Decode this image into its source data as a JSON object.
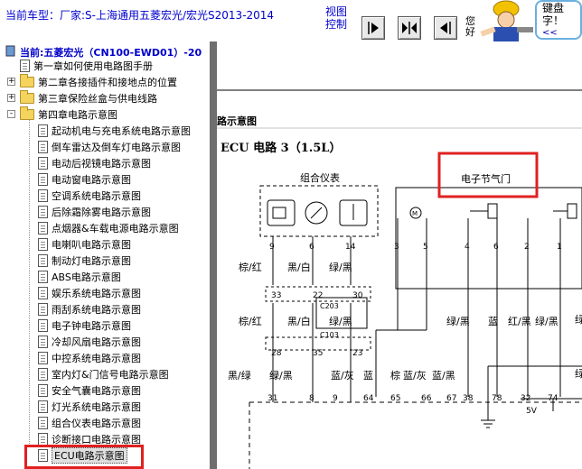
{
  "header": {
    "vehicle_label": "当前车型：厂家:S-上海通用五菱宏光/宏光S2013-2014",
    "view_control_label": "视图\n控制",
    "nav_button_hint": "您好",
    "mascot_text_line1": "键盘",
    "mascot_text_line2": "字！",
    "mascot_more": "<<"
  },
  "tree": {
    "root_label": "当前:五菱宏光（CN100-EWD01）-20",
    "items": [
      {
        "label": "第一章如何使用电路图手册",
        "type": "doc",
        "level": 1
      },
      {
        "label": "第二章各接插件和接地点的位置",
        "type": "folder",
        "level": 1,
        "expander": "+"
      },
      {
        "label": "第三章保险丝盒与供电线路",
        "type": "folder",
        "level": 1,
        "expander": "+"
      },
      {
        "label": "第四章电路示意图",
        "type": "folder",
        "level": 1,
        "expander": "-"
      },
      {
        "label": "起动机电与充电系统电路示意图",
        "type": "doc",
        "level": 2
      },
      {
        "label": "倒车雷达及倒车灯电路示意图",
        "type": "doc",
        "level": 2
      },
      {
        "label": "电动后视镜电路示意图",
        "type": "doc",
        "level": 2
      },
      {
        "label": "电动窗电路示意图",
        "type": "doc",
        "level": 2
      },
      {
        "label": "空调系统电路示意图",
        "type": "doc",
        "level": 2
      },
      {
        "label": "后除霜除雾电路示意图",
        "type": "doc",
        "level": 2
      },
      {
        "label": "点烟器&车载电源电路示意图",
        "type": "doc",
        "level": 2
      },
      {
        "label": "电喇叭电路示意图",
        "type": "doc",
        "level": 2
      },
      {
        "label": "制动灯电路示意图",
        "type": "doc",
        "level": 2
      },
      {
        "label": "ABS电路示意图",
        "type": "doc",
        "level": 2
      },
      {
        "label": "娱乐系统电路示意图",
        "type": "doc",
        "level": 2
      },
      {
        "label": "雨刮系统电路示意图",
        "type": "doc",
        "level": 2
      },
      {
        "label": "电子钟电路示意图",
        "type": "doc",
        "level": 2
      },
      {
        "label": "冷却风扇电路示意图",
        "type": "doc",
        "level": 2
      },
      {
        "label": "中控系统电路示意图",
        "type": "doc",
        "level": 2
      },
      {
        "label": "室内灯&门信号电路示意图",
        "type": "doc",
        "level": 2
      },
      {
        "label": "安全气囊电路示意图",
        "type": "doc",
        "level": 2
      },
      {
        "label": "灯光系统电路示意图",
        "type": "doc",
        "level": 2
      },
      {
        "label": "组合仪表电路示意图",
        "type": "doc",
        "level": 2
      },
      {
        "label": "诊断接口电路示意图",
        "type": "doc",
        "level": 2
      },
      {
        "label": "ECU电路示意图",
        "type": "doc",
        "level": 2,
        "selected": true
      }
    ]
  },
  "diagram": {
    "section_heading": "路示意图",
    "title": "ECU 电路 3（1.5L）",
    "cluster_label": "组合仪表",
    "throttle_label": "电子节气门",
    "top_pins": [
      "9",
      "6",
      "14",
      "3",
      "5",
      "4",
      "6",
      "2",
      "1"
    ],
    "wire_row1": [
      "棕/红",
      "黑/白",
      "绿/黑"
    ],
    "conn_pins_a": [
      "33",
      "22",
      "30"
    ],
    "conn_c203": "C203",
    "conn_c103": "C103",
    "wire_row2": [
      "棕/红",
      "黑/白",
      "绿/黑"
    ],
    "conn_pins_b": [
      "28",
      "35",
      "23"
    ],
    "wire_row3": [
      "黑/绿",
      "绿/黑",
      "蓝/灰",
      "蓝",
      "棕",
      "蓝/灰",
      "蓝/黑"
    ],
    "throttle_wires": [
      "绿/黑",
      "蓝",
      "红/黑",
      "绿/黑"
    ],
    "bottom_pins": [
      "31",
      "8",
      "9",
      "64",
      "65",
      "66",
      "67",
      "38",
      "78",
      "32",
      "74"
    ],
    "supply_label": "5V",
    "right_edge_labels": [
      "绿",
      "绿"
    ]
  },
  "colors": {
    "highlight_red": "#e02020",
    "link_blue": "#0000cc",
    "splitter_gray": "#6e6e6e"
  }
}
